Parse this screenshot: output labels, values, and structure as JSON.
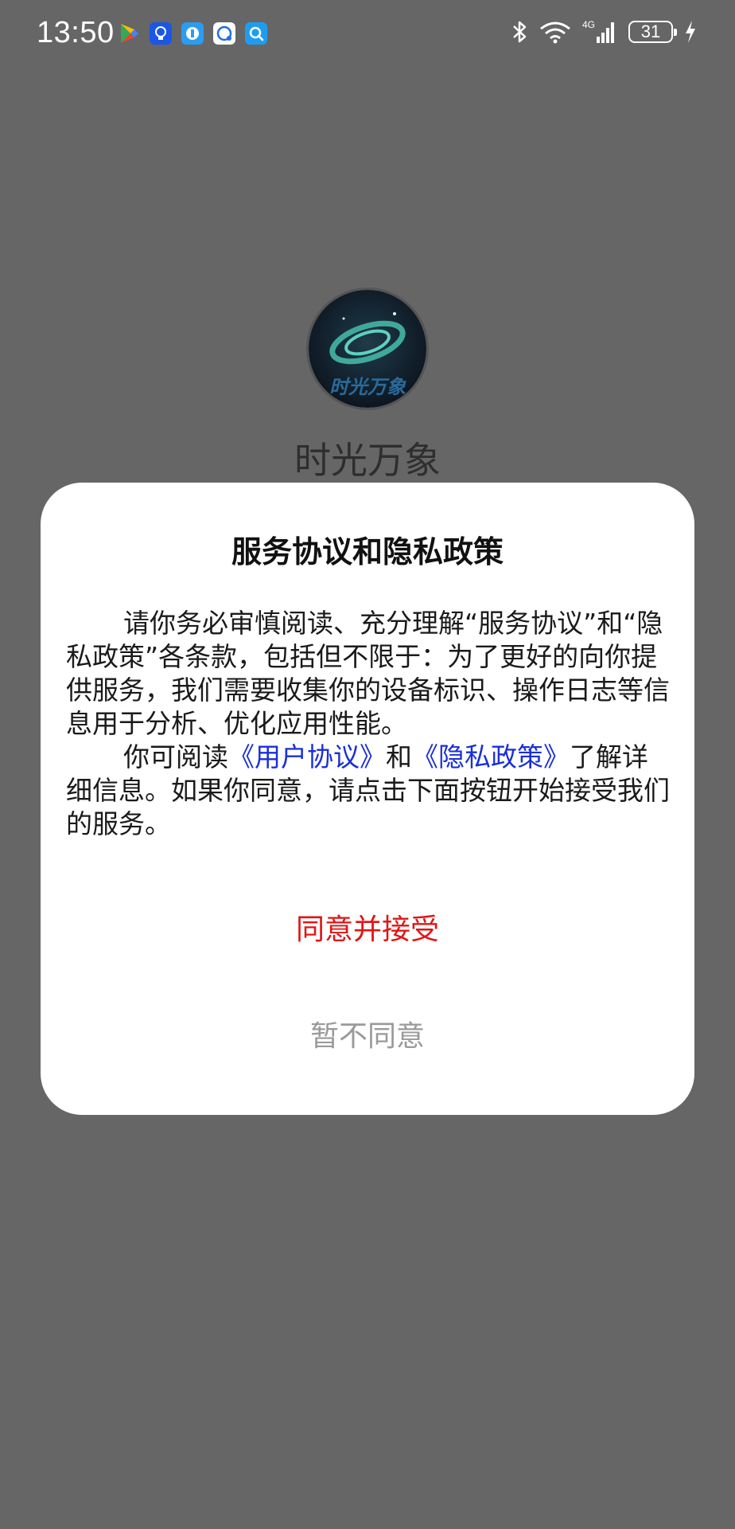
{
  "status_bar": {
    "time": "13:50",
    "network": "4G",
    "battery": "31",
    "notification_icons": [
      {
        "name": "play-store-icon",
        "color": "#34a853"
      },
      {
        "name": "bulb-app-icon",
        "color": "#1a56e8"
      },
      {
        "name": "browser-app-icon",
        "color": "#2b9cf2"
      },
      {
        "name": "chat-app-icon",
        "color": "#ffffff"
      },
      {
        "name": "search-app-icon",
        "color": "#1e9df0"
      }
    ]
  },
  "app": {
    "name": "时光万象",
    "logo_text": "时光万象"
  },
  "dialog": {
    "title": "服务协议和隐私政策",
    "paragraph1": "请你务必审慎阅读、充分理解“服务协议”和“隐私政策”各条款，包括但不限于：为了更好的向你提供服务，我们需要收集你的设备标识、操作日志等信息用于分析、优化应用性能。",
    "paragraph2_prefix": "你可阅读",
    "user_agreement_link": "《用户协议》",
    "paragraph2_and": "和",
    "privacy_policy_link": "《隐私政策》",
    "paragraph2_suffix": "了解详细信息。如果你同意，请点击下面按钮开始接受我们的服务。",
    "agree_label": "同意并接受",
    "decline_label": "暂不同意"
  },
  "colors": {
    "overlay": "#666666",
    "dialog_bg": "#ffffff",
    "link": "#1a2fd8",
    "agree": "#e01515",
    "decline": "#9a9a9a"
  }
}
